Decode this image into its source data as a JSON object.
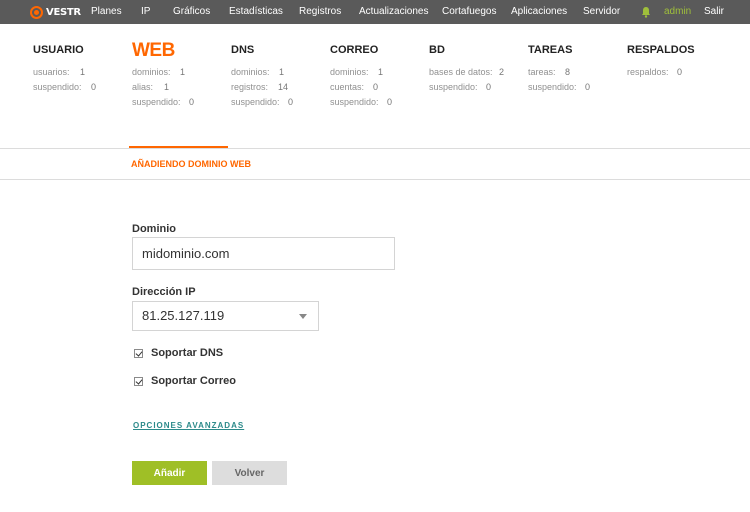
{
  "brand": {
    "name": "VESTR",
    "accent_color": "#ff6701",
    "highlight_color": "#9fbf26"
  },
  "nav": {
    "items": [
      "Planes",
      "IP",
      "Gráficos",
      "Estadísticas",
      "Registros",
      "Actualizaciones",
      "Cortafuegos",
      "Aplicaciones",
      "Servidor"
    ],
    "icon": "bell-icon",
    "user": "admin",
    "logout": "Salir"
  },
  "stats": [
    {
      "title": "USUARIO",
      "rows": [
        {
          "label": "usuarios:",
          "value": "1"
        },
        {
          "label": "suspendido:",
          "value": "0"
        }
      ]
    },
    {
      "title": "WEB",
      "active": true,
      "rows": [
        {
          "label": "dominios:",
          "value": "1"
        },
        {
          "label": "alias:",
          "value": "1"
        },
        {
          "label": "suspendido:",
          "value": "0"
        }
      ]
    },
    {
      "title": "DNS",
      "rows": [
        {
          "label": "dominios:",
          "value": "1"
        },
        {
          "label": "registros:",
          "value": "14"
        },
        {
          "label": "suspendido:",
          "value": "0"
        }
      ]
    },
    {
      "title": "CORREO",
      "rows": [
        {
          "label": "dominios:",
          "value": "1"
        },
        {
          "label": "cuentas:",
          "value": "0"
        },
        {
          "label": "suspendido:",
          "value": "0"
        }
      ]
    },
    {
      "title": "BD",
      "rows": [
        {
          "label": "bases de datos:",
          "value": "2"
        },
        {
          "label": "suspendido:",
          "value": "0"
        }
      ]
    },
    {
      "title": "TAREAS",
      "rows": [
        {
          "label": "tareas:",
          "value": "8"
        },
        {
          "label": "suspendido:",
          "value": "0"
        }
      ]
    },
    {
      "title": "RESPALDOS",
      "rows": [
        {
          "label": "respaldos:",
          "value": "0"
        }
      ]
    }
  ],
  "page": {
    "section_title": "AÑADIENDO DOMINIO WEB"
  },
  "form": {
    "domain": {
      "label": "Dominio",
      "value": "midominio.com"
    },
    "ip": {
      "label": "Dirección IP",
      "selected": "81.25.127.119"
    },
    "checkboxes": [
      {
        "label": "Soportar DNS",
        "checked": true
      },
      {
        "label": "Soportar Correo",
        "checked": true
      }
    ],
    "advanced_link": "OPCIONES AVANZADAS",
    "submit": "Añadir",
    "back": "Volver"
  }
}
